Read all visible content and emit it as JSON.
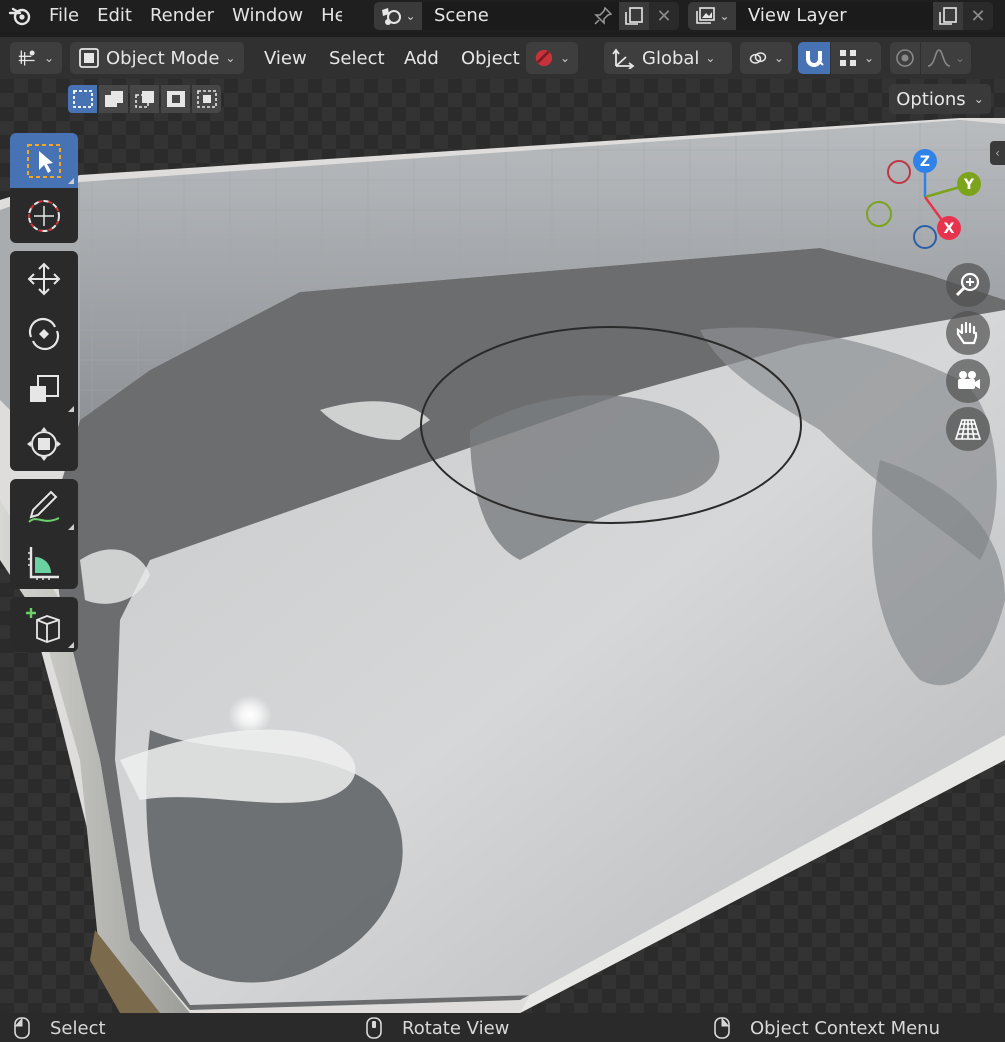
{
  "topbar": {
    "menus": [
      "File",
      "Edit",
      "Render",
      "Window",
      "He"
    ],
    "scene_name": "Scene",
    "view_layer_name": "View Layer"
  },
  "header": {
    "mode": "Object Mode",
    "menus": [
      "View",
      "Select",
      "Add",
      "Object"
    ],
    "transform_orientation": "Global"
  },
  "viewport": {
    "options_label": "Options",
    "gizmo": {
      "x": "X",
      "y": "Y",
      "z": "Z"
    }
  },
  "colors": {
    "accent": "#4772b3",
    "axis_x": "#e8334f",
    "axis_y": "#7ca31c",
    "axis_z": "#2f82e8"
  },
  "statusbar": {
    "left": "Select",
    "middle": "Rotate View",
    "right": "Object Context Menu"
  }
}
